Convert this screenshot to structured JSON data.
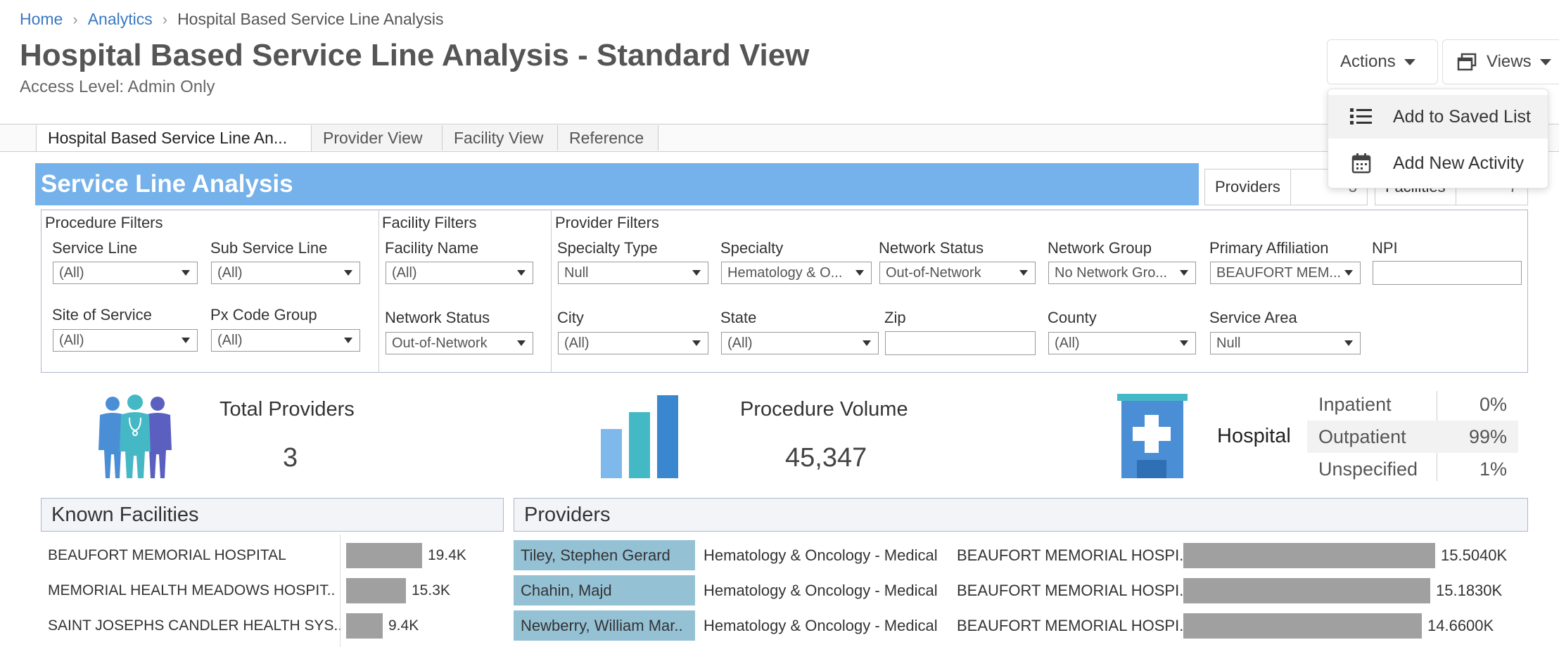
{
  "breadcrumb": [
    "Home",
    "Analytics",
    "Hospital Based Service Line Analysis"
  ],
  "page": {
    "title": "Hospital Based Service Line Analysis - Standard View",
    "access": "Access Level: Admin Only"
  },
  "header_buttons": {
    "actions": "Actions",
    "views": "Views"
  },
  "actions_menu": [
    "Add to Saved List",
    "Add New Activity"
  ],
  "tabs": [
    "Hospital Based Service Line An...",
    "Provider View",
    "Facility View",
    "Reference"
  ],
  "banner": "Service Line Analysis",
  "mini_stats": {
    "providers_label": "Providers",
    "providers_value": "3",
    "facilities_label": "Facilities",
    "facilities_value": "7"
  },
  "filters": {
    "procedure": {
      "heading": "Procedure Filters",
      "service_line": {
        "label": "Service Line",
        "value": "(All)"
      },
      "sub_service_line": {
        "label": "Sub Service Line",
        "value": "(All)"
      },
      "site_of_service": {
        "label": "Site of Service",
        "value": "(All)"
      },
      "px_code_group": {
        "label": "Px Code Group",
        "value": "(All)"
      }
    },
    "facility": {
      "heading": "Facility Filters",
      "facility_name": {
        "label": "Facility Name",
        "value": "(All)"
      },
      "network_status": {
        "label": "Network Status",
        "value": "Out-of-Network"
      }
    },
    "provider": {
      "heading": "Provider Filters",
      "specialty_type": {
        "label": "Specialty Type",
        "value": "Null"
      },
      "specialty": {
        "label": "Specialty",
        "value": "Hematology & O..."
      },
      "network_status": {
        "label": "Network Status",
        "value": "Out-of-Network"
      },
      "network_group": {
        "label": "Network Group",
        "value": "No Network Gro..."
      },
      "primary_affiliation": {
        "label": "Primary Affiliation",
        "value": "BEAUFORT MEM..."
      },
      "npi": {
        "label": "NPI",
        "value": ""
      },
      "city": {
        "label": "City",
        "value": "(All)"
      },
      "state": {
        "label": "State",
        "value": "(All)"
      },
      "zip": {
        "label": "Zip",
        "value": ""
      },
      "county": {
        "label": "County",
        "value": "(All)"
      },
      "service_area": {
        "label": "Service Area",
        "value": "Null"
      }
    }
  },
  "kpis": {
    "total_providers": {
      "label": "Total Providers",
      "value": "3"
    },
    "procedure_volume": {
      "label": "Procedure Volume",
      "value": "45,347"
    },
    "hospital": {
      "label": "Hospital",
      "rows": [
        {
          "name": "Inpatient",
          "value": "0%"
        },
        {
          "name": "Outpatient",
          "value": "99%"
        },
        {
          "name": "Unspecified",
          "value": "1%"
        }
      ]
    }
  },
  "known_facilities": {
    "title": "Known Facilities",
    "rows": [
      {
        "name": "BEAUFORT MEMORIAL HOSPITAL",
        "label": "19.4K",
        "value": 19.4
      },
      {
        "name": "MEMORIAL HEALTH MEADOWS HOSPIT..",
        "label": "15.3K",
        "value": 15.3
      },
      {
        "name": "SAINT JOSEPHS CANDLER HEALTH SYS..",
        "label": "9.4K",
        "value": 9.4
      }
    ]
  },
  "providers_table": {
    "title": "Providers",
    "rows": [
      {
        "name": "Tiley, Stephen Gerard",
        "specialty": "Hematology & Oncology - Medical",
        "facility": "BEAUFORT MEMORIAL HOSPI..",
        "label": "15.5040K",
        "value": 15.504
      },
      {
        "name": "Chahin, Majd",
        "specialty": "Hematology & Oncology - Medical",
        "facility": "BEAUFORT MEMORIAL HOSPI..",
        "label": "15.1830K",
        "value": 15.183
      },
      {
        "name": "Newberry, William Mar..",
        "specialty": "Hematology & Oncology - Medical",
        "facility": "BEAUFORT MEMORIAL HOSPI..",
        "label": "14.6600K",
        "value": 14.66
      }
    ]
  },
  "colors": {
    "banner": "#75b1ea",
    "link": "#3a79c2",
    "provider_name_bg": "#95c1d5",
    "bar": "#a0a0a0",
    "icon_blue": "#4a8fd6",
    "icon_teal": "#45b8c6",
    "icon_purple": "#5a5fc0"
  }
}
